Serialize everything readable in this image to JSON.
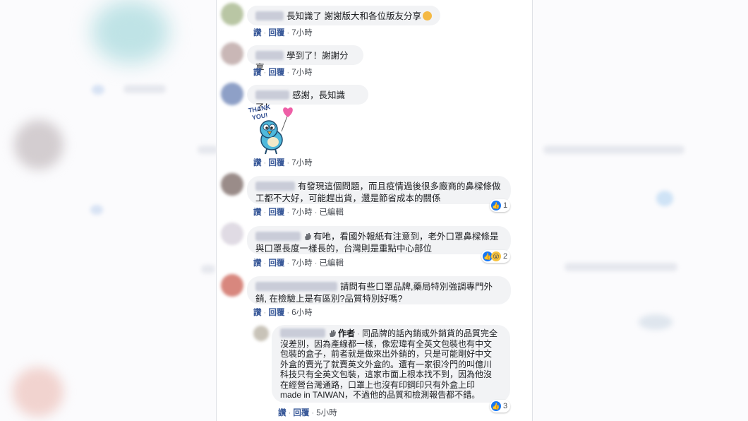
{
  "actions": {
    "like": "讚",
    "reply": "回覆",
    "edited": "已編輯"
  },
  "author_badge": "作者",
  "colors": {
    "like_blue": "#1877f2",
    "link_blue": "#385898",
    "bubble_bg": "#f2f3f5"
  },
  "sticker": {
    "icon": "thank-you-bird-sticker",
    "text_line1": "THANK",
    "text_line2": "YOU!"
  },
  "comments": [
    {
      "text": "長知識了 謝謝版大和各位版友分享",
      "time": "7小時"
    },
    {
      "text": "學到了！謝謝分享",
      "time": "7小時"
    },
    {
      "text": "感謝，長知識了！",
      "time": "7小時"
    },
    {
      "text_line1": "有發現這個問題，而且疫情過後很多廠商的鼻樑條做",
      "text_line2": "工都不大好，可能趕出貨，還是節省成本的關係",
      "time": "7小時",
      "reactions": "1"
    },
    {
      "text_line1": "有吔，看國外報紙有注意到，老外口罩鼻樑條是",
      "text_line2": "與口罩長度一樣長的，台灣則是重點中心部位",
      "time": "7小時",
      "reactions": "2"
    },
    {
      "text_line1": "請問有些口罩品牌,藥局特別強調專門外",
      "text_line2": "銷, 在檢驗上是有區別?品質特別好嗎?",
      "time": "6小時"
    },
    {
      "lines": [
        "同品牌的話內銷或外銷貨的品質完全",
        "沒差別，因為產線都一樣，像宏瑋有全英文包裝也有中文",
        "包裝的盒子，前者就是做來出外銷的，只是可能剛好中文",
        "外盒的賣光了就賣英文外盒的。還有一家很冷門的叫億川",
        "科技只有全英文包裝，這家市面上根本找不到，因為他沒",
        "在經營台灣通路，口罩上也沒有印鋼印只有外盒上印",
        "made in TAIWAN，不過他的品質和檢測報告都不錯。"
      ],
      "time": "5小時",
      "reactions": "3"
    }
  ]
}
